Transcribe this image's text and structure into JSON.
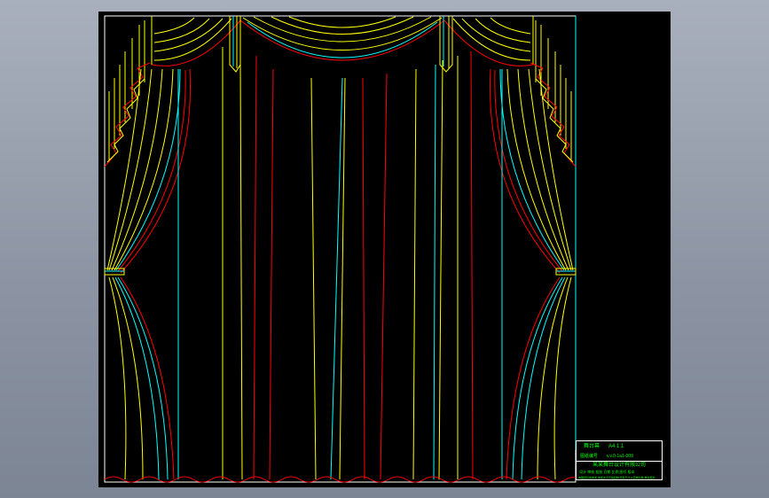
{
  "window": {
    "background": "#9aa1ae"
  },
  "canvas": {
    "background": "#000000",
    "colors": {
      "yellow": "#ffff00",
      "cyan": "#00ffff",
      "red": "#ff0000",
      "white": "#ffffff",
      "green": "#00ff00"
    }
  },
  "drawing": {
    "subject": "stage curtain with valance swags and tie-backs"
  },
  "title_block": {
    "row1_a": "舞台幕",
    "row1_b": "A4  1:1",
    "row2_a": "图纸编号",
    "row2_b": "v.v.0-1a1-009",
    "row3": "某某舞台设计有限公司",
    "row4": "设计 审核 批准 日期 比例 图号 版本",
    "row5": "本图纸仅供参考 未经许可不得复制 所有尺寸以实物为准 单位毫米"
  }
}
